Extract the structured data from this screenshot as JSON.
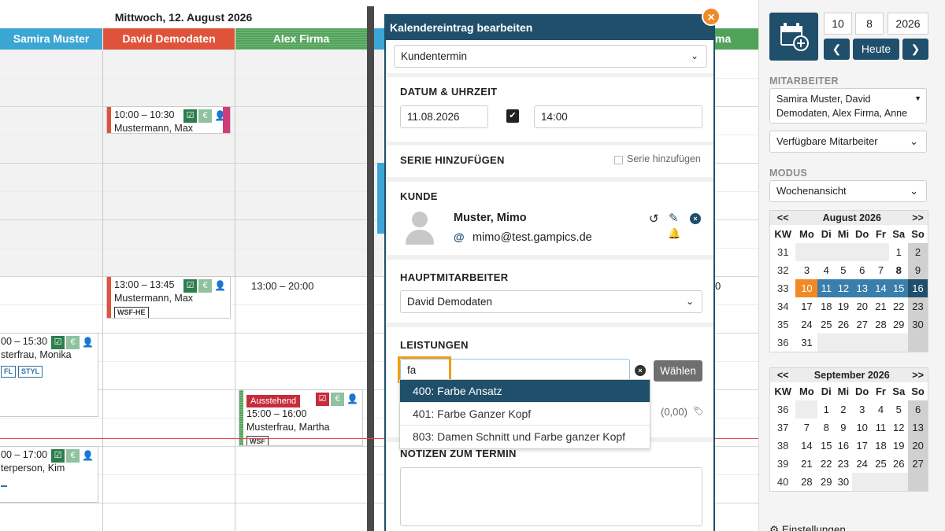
{
  "calendar": {
    "day_title": "Mittwoch, 12. August 2026",
    "columns": [
      {
        "name": "Samira Muster",
        "color": "#3ba6d4"
      },
      {
        "name": "David Demodaten",
        "color": "#e0533b"
      },
      {
        "name": "Alex Firma",
        "color": "#52a35a"
      }
    ],
    "hidden_column_tail": "ma",
    "right_time_fragment": "0",
    "appointments": [
      {
        "time": "10:00 – 10:30",
        "name": "Mustermann, Max"
      },
      {
        "time": "13:00 – 13:45",
        "name": "Mustermann, Max",
        "tags": [
          "WSF-HE"
        ]
      },
      {
        "time": "13:00 – 20:00"
      },
      {
        "time": "00 – 15:30",
        "name": "sterfrau, Monika",
        "tags": [
          "FL",
          "STYL"
        ]
      },
      {
        "status": "Ausstehend",
        "time": "15:00 – 16:00",
        "name": "Musterfrau, Martha",
        "tags": [
          "WSF"
        ]
      },
      {
        "time": "00 – 17:00",
        "name": "terperson, Kim"
      }
    ]
  },
  "dialog": {
    "title": "Kalendereintrag bearbeiten",
    "type_select": "Kundentermin",
    "datetime": {
      "label": "DATUM & UHRZEIT",
      "date": "11.08.2026",
      "time": "14:00"
    },
    "series": {
      "label": "SERIE HINZUFÜGEN",
      "checkbox_label": "Serie hinzufügen"
    },
    "customer": {
      "label": "KUNDE",
      "name": "Muster, Mimo",
      "email": "mimo@test.gampics.de"
    },
    "main_employee": {
      "label": "HAUPTMITARBEITER",
      "value": "David Demodaten"
    },
    "services": {
      "label": "LEISTUNGEN",
      "search_value": "fa",
      "choose_button": "Wählen",
      "price": "(0,00)",
      "suggestions": [
        "400: Farbe Ansatz",
        "401: Farbe Ganzer Kopf",
        "803: Damen Schnitt und Farbe ganzer Kopf"
      ]
    },
    "notes": {
      "label": "NOTIZEN ZUM TERMIN"
    }
  },
  "panel": {
    "day": "10",
    "month": "8",
    "year": "2026",
    "today_button": "Heute",
    "employees_label": "MITARBEITER",
    "employees_value": "Samira Muster, David Demodaten, Alex Firma, Anne",
    "available_select": "Verfügbare Mitarbeiter",
    "mode_label": "MODUS",
    "mode_value": "Wochenansicht",
    "settings_label": "Einstellungen",
    "august": {
      "title": "August 2026",
      "rows": [
        [
          "31",
          "",
          "",
          "",
          "",
          "",
          "1",
          "2"
        ],
        [
          "32",
          "3",
          "4",
          "5",
          "6",
          "7",
          "8",
          "9"
        ],
        [
          "33",
          "10",
          "11",
          "12",
          "13",
          "14",
          "15",
          "16"
        ],
        [
          "34",
          "17",
          "18",
          "19",
          "20",
          "21",
          "22",
          "23"
        ],
        [
          "35",
          "24",
          "25",
          "26",
          "27",
          "28",
          "29",
          "30"
        ],
        [
          "36",
          "31",
          "",
          "",
          "",
          "",
          "",
          ""
        ]
      ]
    },
    "september": {
      "title": "September 2026",
      "rows": [
        [
          "36",
          "",
          "1",
          "2",
          "3",
          "4",
          "5",
          "6"
        ],
        [
          "37",
          "7",
          "8",
          "9",
          "10",
          "11",
          "12",
          "13"
        ],
        [
          "38",
          "14",
          "15",
          "16",
          "17",
          "18",
          "19",
          "20"
        ],
        [
          "39",
          "21",
          "22",
          "23",
          "24",
          "25",
          "26",
          "27"
        ],
        [
          "40",
          "28",
          "29",
          "30",
          "",
          "",
          "",
          ""
        ]
      ]
    },
    "weekday_headers": [
      "KW",
      "Mo",
      "Di",
      "Mi",
      "Do",
      "Fr",
      "Sa",
      "So"
    ],
    "prev_nav": "<<",
    "next_nav": ">>"
  }
}
